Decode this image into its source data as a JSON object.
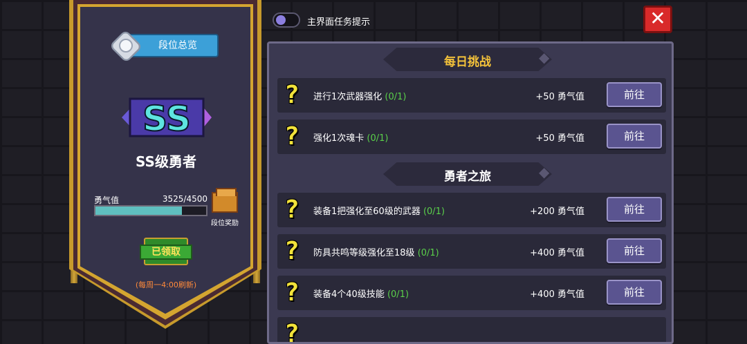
{
  "toggle": {
    "label": "主界面任务提示"
  },
  "close": {
    "glyph": "✕"
  },
  "left": {
    "rank_button": "段位总览",
    "rank_logo": "SS",
    "rank_name": "SS级勇者",
    "valor_label": "勇气值",
    "valor_value": "3525/4500",
    "valor_fraction": 0.783,
    "chest_label": "段位奖励",
    "claimed_label": "已领取",
    "refresh_note": "(每周一4:00刷新)"
  },
  "sections": {
    "daily": {
      "title": "每日挑战"
    },
    "journey": {
      "title": "勇者之旅"
    }
  },
  "tasks": [
    {
      "text": "进行1次武器强化",
      "progress": "(0/1)",
      "reward": "+50 勇气值",
      "button": "前往"
    },
    {
      "text": "强化1次魂卡",
      "progress": "(0/1)",
      "reward": "+50 勇气值",
      "button": "前往"
    },
    {
      "text": "装备1把强化至60级的武器",
      "progress": "(0/1)",
      "reward": "+200 勇气值",
      "button": "前往"
    },
    {
      "text": "防具共鸣等级强化至18级",
      "progress": "(0/1)",
      "reward": "+400 勇气值",
      "button": "前往"
    },
    {
      "text": "装备4个40级技能",
      "progress": "(0/1)",
      "reward": "+400 勇气值",
      "button": "前往"
    }
  ],
  "colors": {
    "accent_gold": "#f4c23a",
    "progress_green": "#5ad04a",
    "valor_fill": "#5fbfbf",
    "close_red": "#d92a2a"
  }
}
